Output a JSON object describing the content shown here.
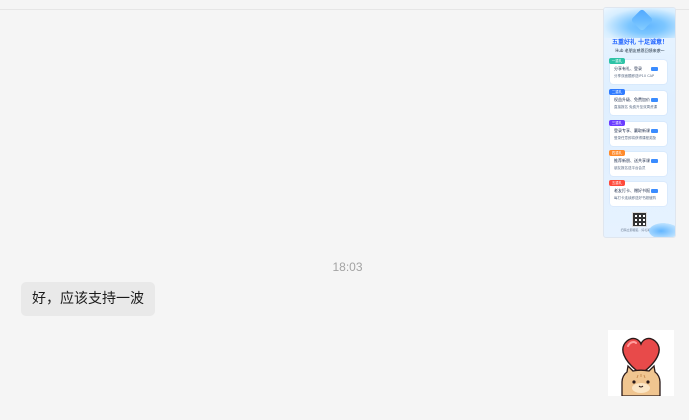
{
  "messages": {
    "timestamp": "18:03",
    "text_message": "好，应该支持一波"
  },
  "poster": {
    "icon": "promo-poster-image",
    "headline": "五重好礼 十足诚意！",
    "subtitle": "Hub 老朋友感恩回馈来袭～",
    "cards": [
      {
        "tag": "一重礼",
        "title": "分享有礼、登录",
        "detail": "分享双面题即送IP10 CAP",
        "tag_color": "#2ec3a6"
      },
      {
        "tag": "二重礼",
        "title": "权益升级、免费加价",
        "detail": "直接报名 免费升至双周资课",
        "tag_color": "#2f7bff"
      },
      {
        "tag": "三重礼",
        "title": "登录专享、赢取新课",
        "detail": "登录任意即将获得课程奖励",
        "tag_color": "#6b3cff"
      },
      {
        "tag": "四重礼",
        "title": "推荐新朋、送共享课",
        "detail": "朋友报名送平台会员",
        "tag_color": "#ff8a2a"
      },
      {
        "tag": "五重礼",
        "title": "老友打卡、赠好书报",
        "detail": "每打卡连续即送好书超值购",
        "tag_color": "#ff4a3a"
      }
    ],
    "footer": "扫码立即报名 · 好礼等你来拿",
    "colors": {
      "accent": "#1f63ff",
      "background": "#e6f2ff"
    }
  },
  "sticker": {
    "icon": "heart-cat-sticker",
    "colors": {
      "heart": "#e84a4a",
      "cat": "#f0c590"
    }
  }
}
